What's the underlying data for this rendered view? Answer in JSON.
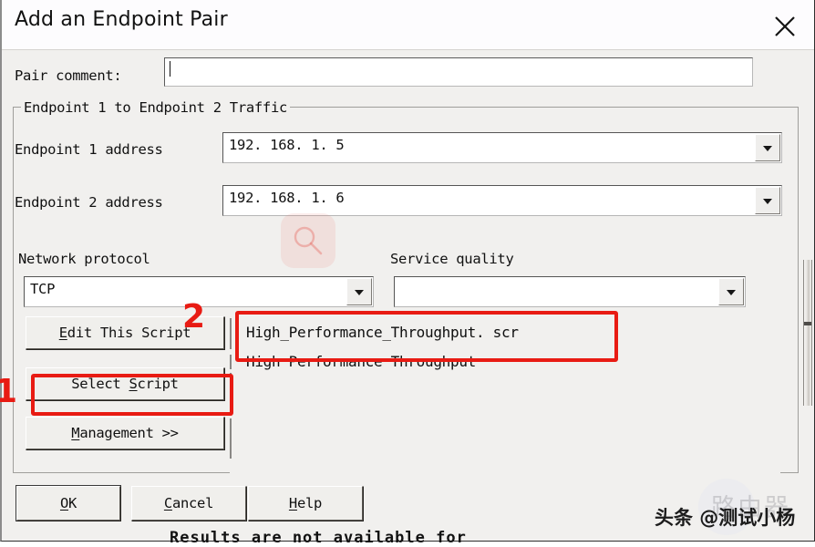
{
  "window": {
    "title": "Add an Endpoint Pair",
    "close_icon": "close-icon"
  },
  "form": {
    "pair_comment_label": "Pair comment:",
    "pair_comment_value": "",
    "pair_comment_placeholder": ""
  },
  "group": {
    "title": "Endpoint 1 to Endpoint 2 Traffic",
    "endpoint1_label": "Endpoint 1 address",
    "endpoint1_value": "192. 168. 1. 5",
    "endpoint2_label": "Endpoint 2 address",
    "endpoint2_value": "192. 168. 1. 6",
    "network_protocol_label": "Network protocol",
    "network_protocol_value": "TCP",
    "service_quality_label": "Service quality",
    "service_quality_value": ""
  },
  "script_buttons": {
    "edit_this_script": "Edit This Script",
    "edit_this_script_accel": "E",
    "select_script": "Select Script",
    "select_script_accel": "S",
    "management": "Management >>",
    "management_accel": "M"
  },
  "script_list": {
    "items": [
      "High_Performance_Throughput. scr",
      "High Performance Throughput"
    ]
  },
  "dialog_buttons": {
    "ok": "OK",
    "ok_accel": "O",
    "cancel": "Cancel",
    "cancel_accel": "C",
    "help": "Help",
    "help_accel": "H"
  },
  "annotations": {
    "step_one": "1",
    "step_two": "2",
    "accent_color": "#e81b13"
  },
  "watermark": {
    "brand_big": "路由器",
    "byline": "头条 @测试小杨",
    "search_icon": "search-icon"
  },
  "bleed": {
    "partial_text": "Results are not available for"
  }
}
